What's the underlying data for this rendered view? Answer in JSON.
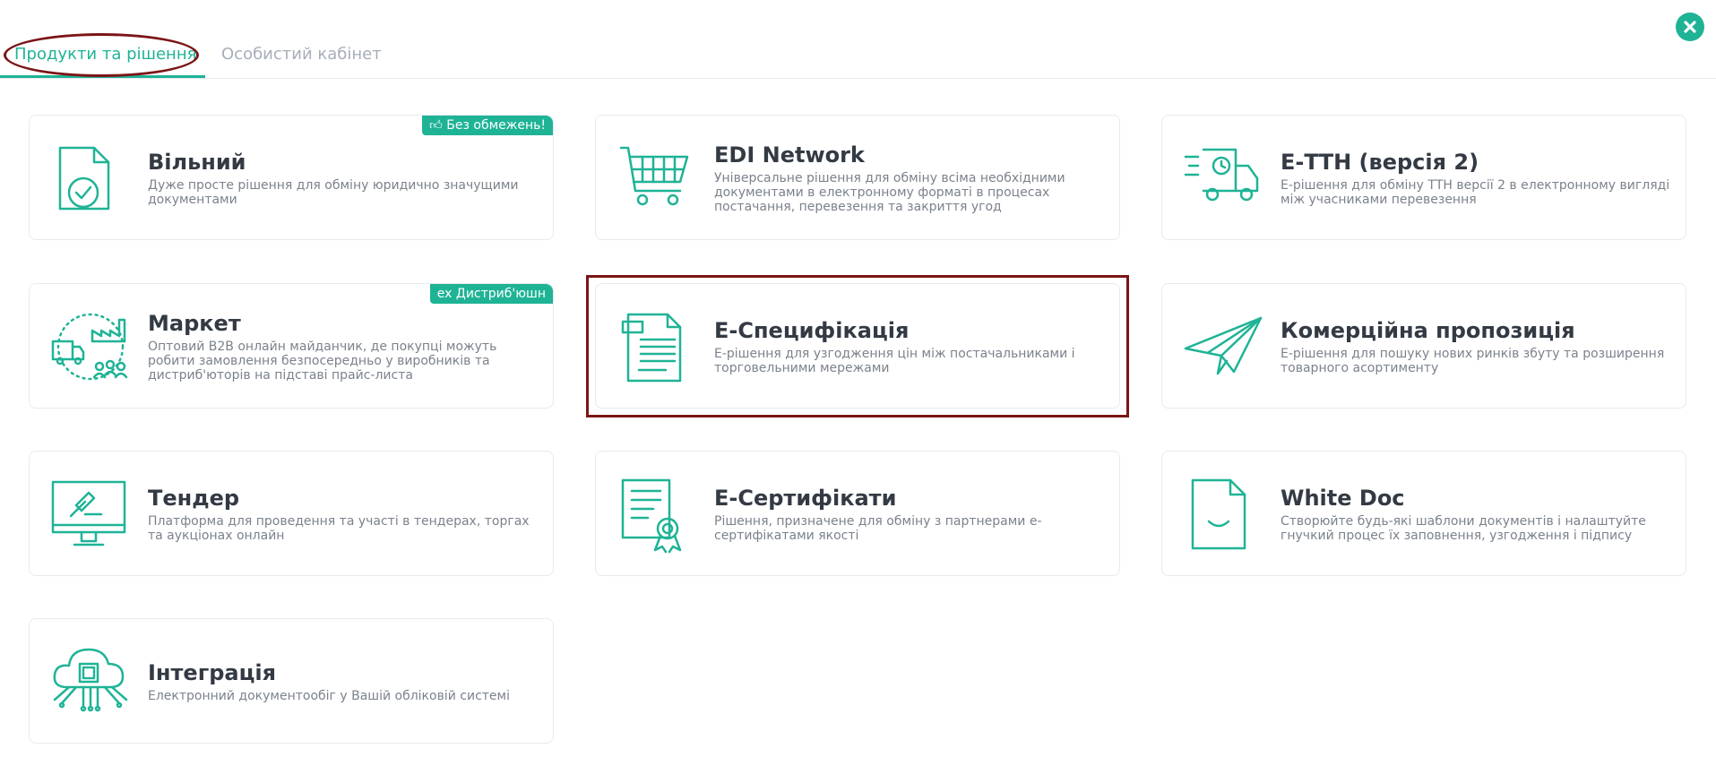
{
  "tabs": {
    "active": "Продукти та рішення",
    "inactive": "Особистий кабінет"
  },
  "colors": {
    "accent": "#1fb396",
    "highlight": "#7b1516"
  },
  "cards": {
    "vilnyi": {
      "title": "Вільний",
      "desc": "Дуже просте рішення для обміну юридично значущими документами",
      "badge": "Без обмежень!",
      "icon": "document-check-icon"
    },
    "edi": {
      "title": "EDI Network",
      "desc": "Універсальне рішення для обміну всіма необхідними документами в електронному форматі в процесах постачання, перевезення та закриття угод",
      "icon": "shopping-cart-icon"
    },
    "ettn": {
      "title": "Е-ТТН (версія 2)",
      "desc": "Е-рішення для обміну ТТН версії 2 в електронному вигляді між учасниками перевезення",
      "icon": "delivery-truck-icon"
    },
    "market": {
      "title": "Маркет",
      "desc": "Оптовий B2B онлайн майданчик, де покупці можуть робити замовлення безпосередньо у виробників та дистриб'юторів на підставі прайс-листа",
      "badge": "ex Дистриб'юшн",
      "icon": "factory-truck-people-icon"
    },
    "espec": {
      "title": "Е-Специфікація",
      "desc": "Е-рішення для узгодження цін між постачальниками і торговельними мережами",
      "icon": "spec-document-icon"
    },
    "kompro": {
      "title": "Комерційна пропозиція",
      "desc": "Е-рішення для пошуку нових ринків збуту та розширення товарного асортименту",
      "icon": "paper-plane-icon"
    },
    "tender": {
      "title": "Тендер",
      "desc": "Платформа для проведення та участі в тендерах, торгах та аукціонах онлайн",
      "icon": "monitor-gavel-icon"
    },
    "ecert": {
      "title": "Е-Сертифікати",
      "desc": "Рішення, призначене для обміну з партнерами е-сертифікатами якості",
      "icon": "certificate-icon"
    },
    "whitedoc": {
      "title": "White Doc",
      "desc": "Створюйте будь-які шаблони документів і налаштуйте гнучкий процес їх заповнення, узгодження і підпису",
      "icon": "smile-document-icon"
    },
    "integr": {
      "title": "Інтеграція",
      "desc": "Електронний документообіг у Вашій обліковій системі",
      "icon": "cloud-chip-icon"
    }
  }
}
